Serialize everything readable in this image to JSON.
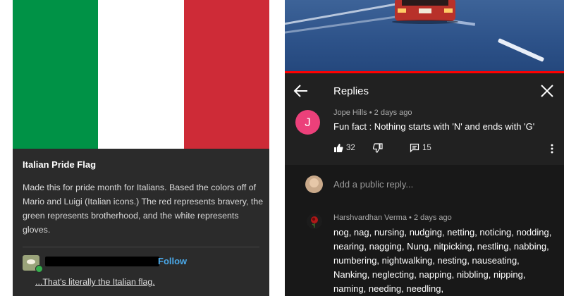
{
  "left_post": {
    "flag": {
      "colors": [
        "#009246",
        "#ffffff",
        "#ce2b37"
      ]
    },
    "title": "Italian Pride Flag",
    "body": "Made this for pride month for Italians. Based the colors off of Mario and Luigi (Italian icons.) The red represents bravery, the green represents brotherhood, and the white represents gloves.",
    "follow_label": "Follow",
    "reblog_comment": "...That's literally the Italian flag."
  },
  "right_panel": {
    "header": {
      "title": "Replies"
    },
    "comment": {
      "avatar_letter": "J",
      "author": "Jope Hills",
      "time": "2 days ago",
      "text": "Fun fact : Nothing starts with 'N' and ends with 'G'",
      "likes": "32",
      "replies_count": "15"
    },
    "add_reply": {
      "placeholder": "Add a public reply..."
    },
    "reply": {
      "author": "Harshvardhan Verma",
      "time": "2 days ago",
      "text": "nog, nag, nursing, nudging, netting, noticing, nodding, nearing, nagging, Nung, nitpicking, nestling, nabbing, numbering, nightwalking, nesting, nauseating, Nanking, neglecting, napping, nibbling, nipping, naming, needing, needling,"
    },
    "colors": {
      "accent": "#ff0000",
      "avatar_j": "#ec407a"
    }
  }
}
